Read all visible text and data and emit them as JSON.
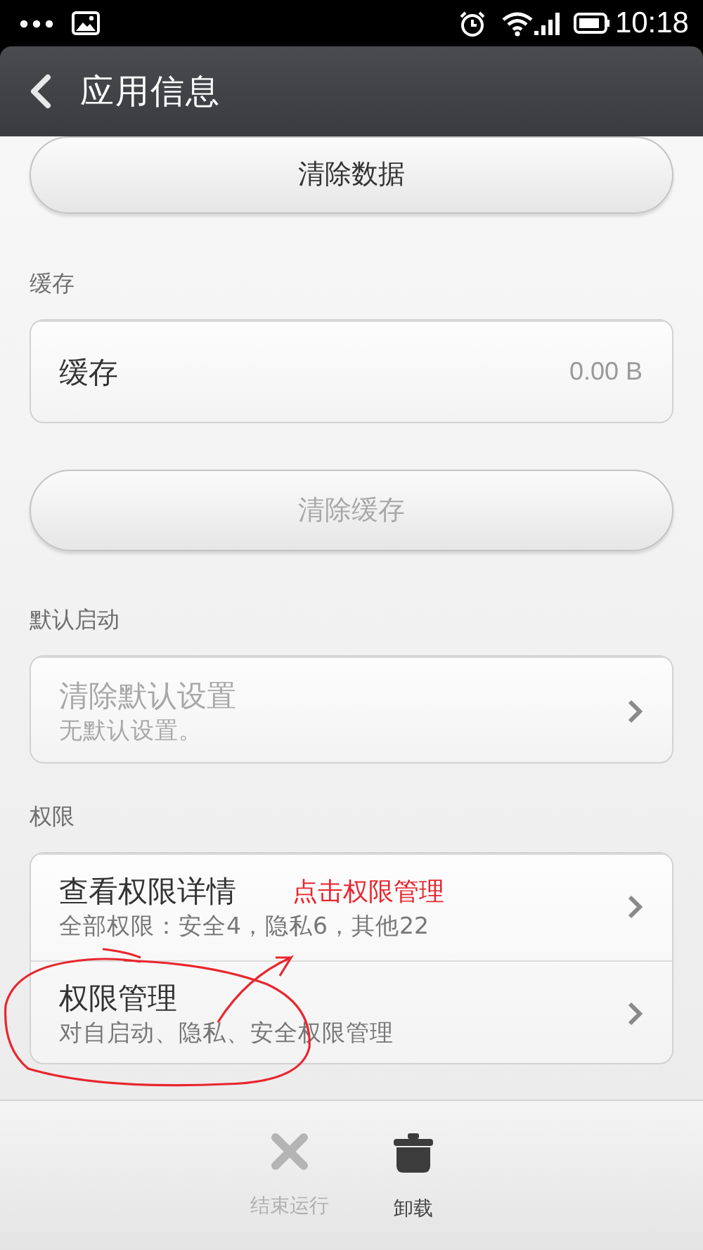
{
  "status_bar": {
    "time": "10:18"
  },
  "header": {
    "title": "应用信息"
  },
  "content": [
    {
      "kind": "button",
      "label": "清除数据",
      "disabled": false
    },
    {
      "kind": "label",
      "text": "缓存"
    },
    {
      "kind": "card",
      "rows": [
        {
          "title": "缓存",
          "value": "0.00 B",
          "chevron": false,
          "disabled": false
        }
      ]
    },
    {
      "kind": "button",
      "label": "清除缓存",
      "disabled": true
    },
    {
      "kind": "label",
      "text": "默认启动"
    },
    {
      "kind": "card",
      "rows": [
        {
          "title": "清除默认设置",
          "subtitle": "无默认设置。",
          "chevron": true,
          "disabled": true
        }
      ]
    },
    {
      "kind": "label",
      "text": "权限"
    },
    {
      "kind": "card",
      "rows": [
        {
          "title": "查看权限详情",
          "subtitle": "全部权限：安全4，隐私6，其他22",
          "chevron": true,
          "disabled": false
        },
        {
          "title": "权限管理",
          "subtitle": "对自启动、隐私、安全权限管理",
          "chevron": true,
          "disabled": false
        }
      ]
    }
  ],
  "annotation": {
    "text": "点击权限管理"
  },
  "bottom_bar": [
    {
      "kind": "stop",
      "label": "结束运行",
      "disabled": true
    },
    {
      "kind": "uninstall",
      "label": "卸载",
      "disabled": false
    }
  ]
}
